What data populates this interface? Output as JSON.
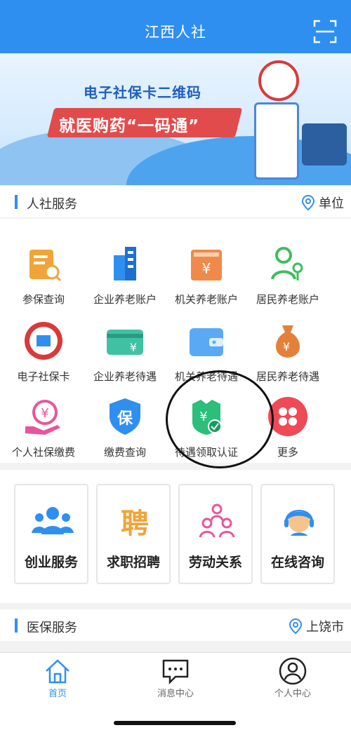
{
  "header": {
    "title": "江西人社"
  },
  "banner": {
    "headline1": "电子社保卡二维码",
    "headline2": "就医购药“一码通”"
  },
  "section_hr": {
    "label": "人社服务",
    "location": "单位"
  },
  "services": [
    {
      "label": "参保查询",
      "icon": "clipboard-search-icon"
    },
    {
      "label": "企业养老账户",
      "icon": "building-icon"
    },
    {
      "label": "机关养老账户",
      "icon": "yuan-box-icon"
    },
    {
      "label": "居民养老账户",
      "icon": "person-key-icon"
    },
    {
      "label": "电子社保卡",
      "icon": "social-security-card-icon"
    },
    {
      "label": "企业养老待遇",
      "icon": "card-yuan-icon"
    },
    {
      "label": "机关养老待遇",
      "icon": "wallet-icon"
    },
    {
      "label": "居民养老待遇",
      "icon": "money-bag-icon"
    },
    {
      "label": "个人社保缴费",
      "icon": "hand-yuan-icon"
    },
    {
      "label": "缴费查询",
      "icon": "shield-bao-icon"
    },
    {
      "label": "待遇领取认证",
      "icon": "verified-yuan-icon"
    },
    {
      "label": "更多",
      "icon": "more-grid-icon"
    }
  ],
  "cards": [
    {
      "label": "创业服务",
      "icon": "group-icon"
    },
    {
      "label": "求职招聘",
      "icon": "zhaopin-icon"
    },
    {
      "label": "劳动关系",
      "icon": "org-chart-icon"
    },
    {
      "label": "在线咨询",
      "icon": "consultant-icon"
    }
  ],
  "section_med": {
    "label": "医保服务",
    "location": "上饶市"
  },
  "tabs": [
    {
      "label": "首页",
      "icon": "home-icon"
    },
    {
      "label": "消息中心",
      "icon": "message-icon"
    },
    {
      "label": "个人中心",
      "icon": "profile-icon"
    }
  ],
  "colors": {
    "primary": "#2f8ff0",
    "red": "#e24b4b",
    "orange": "#f0a43a",
    "green": "#2bbf7a"
  }
}
